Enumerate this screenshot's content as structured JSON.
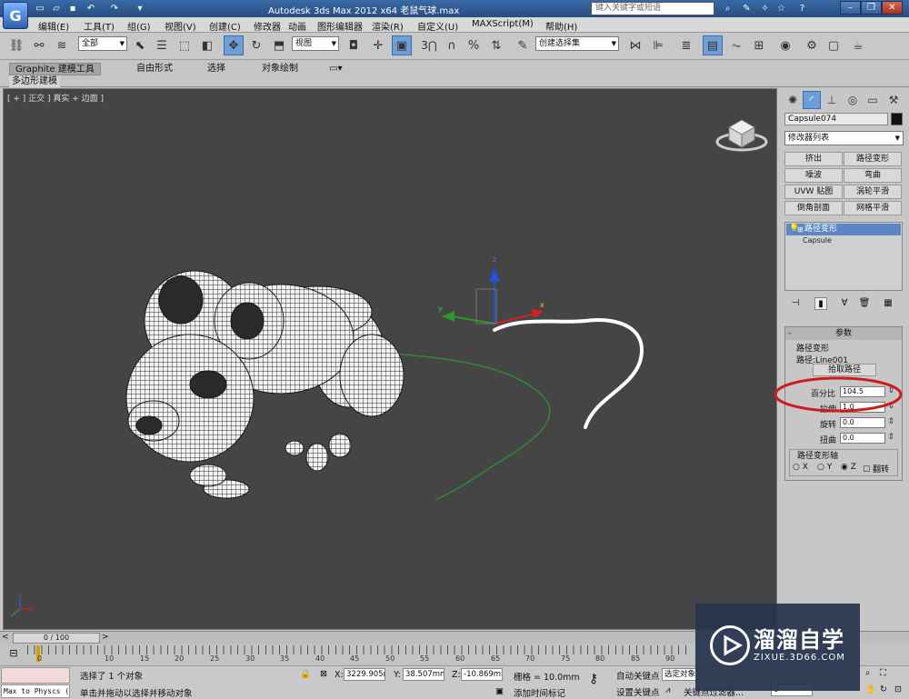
{
  "titlebar": {
    "logo_letter": "G",
    "title": "Autodesk 3ds Max  2012 x64    老鼠气球.max",
    "help_search_placeholder": "键入关键字或短语",
    "min": "–",
    "max": "❐",
    "close": "✕"
  },
  "menu": [
    "编辑(E)",
    "工具(T)",
    "组(G)",
    "视图(V)",
    "创建(C)",
    "修改器",
    "动画",
    "图形编辑器",
    "渲染(R)",
    "自定义(U)",
    "MAXScript(M)",
    "帮助(H)"
  ],
  "toolbar": {
    "selection_filter": "全部",
    "ref_coord": "视图",
    "named_selection": "创建选择集",
    "snap_label": "3",
    "percent_label": "%"
  },
  "ribbon": {
    "tabs": [
      "Graphite 建模工具",
      "自由形式",
      "选择",
      "对象绘制"
    ],
    "panel_label": "多边形建模"
  },
  "viewport": {
    "label": "[ + ] 正交 ] 真实 + 边面 ]",
    "gizmo_axes": {
      "x": "x",
      "y": "y",
      "z": "z"
    }
  },
  "command_panel": {
    "object_name": "Capsule074",
    "modifier_list": "修改器列表",
    "mod_buttons": [
      [
        "挤出",
        "路径变形"
      ],
      [
        "噪波",
        "弯曲"
      ],
      [
        "UVW 贴图",
        "涡轮平滑"
      ],
      [
        "倒角剖面",
        "网格平滑"
      ]
    ],
    "stack": {
      "selected": "路径变形",
      "base": "Capsule"
    },
    "params": {
      "title": "参数",
      "group": "路径变形",
      "path_label": "路径:",
      "path_value": "Line001",
      "pick_path": "拾取路径",
      "percent_label": "百分比",
      "percent_value": "104.5",
      "stretch_label": "拉伸",
      "stretch_value": "1.0",
      "rotate_label": "旋转",
      "rotate_value": "0.0",
      "twist_label": "扭曲",
      "twist_value": "0.0",
      "axis_group": "路径变形轴",
      "axes": [
        "X",
        "Y",
        "Z"
      ],
      "flip": "翻转"
    }
  },
  "timeline": {
    "frame": "0 / 100",
    "ticks": [
      "0",
      "10",
      "15",
      "20",
      "25",
      "30",
      "35",
      "40",
      "45",
      "50",
      "55",
      "60",
      "65",
      "70",
      "75",
      "80",
      "85",
      "90"
    ]
  },
  "status": {
    "maxscript_line": "Max to Physcs (",
    "selected": "选择了 1 个对象",
    "prompt": "单击并拖动以选择并移动对象",
    "x_label": "X:",
    "x_value": "3229.905m",
    "y_label": "Y:",
    "y_value": "38.507mm",
    "z_label": "Z:",
    "z_value": "-10.869mm",
    "grid": "栅格 = 10.0mm",
    "add_time_tag": "添加时间标记",
    "auto_key": "自动关键点",
    "set_key": "设置关键点",
    "selected_obj": "选定对象",
    "key_filters": "关键点过滤器...",
    "frame_field": "0"
  },
  "watermark": {
    "title": "溜溜自学",
    "subtitle": "ZIXUE.3D66.COM"
  },
  "colors": {
    "viewport_bg": "#454545",
    "highlight_red": "#d11a1a",
    "spline_green": "#2f8a3a",
    "selection_blue": "#5b87c5"
  }
}
